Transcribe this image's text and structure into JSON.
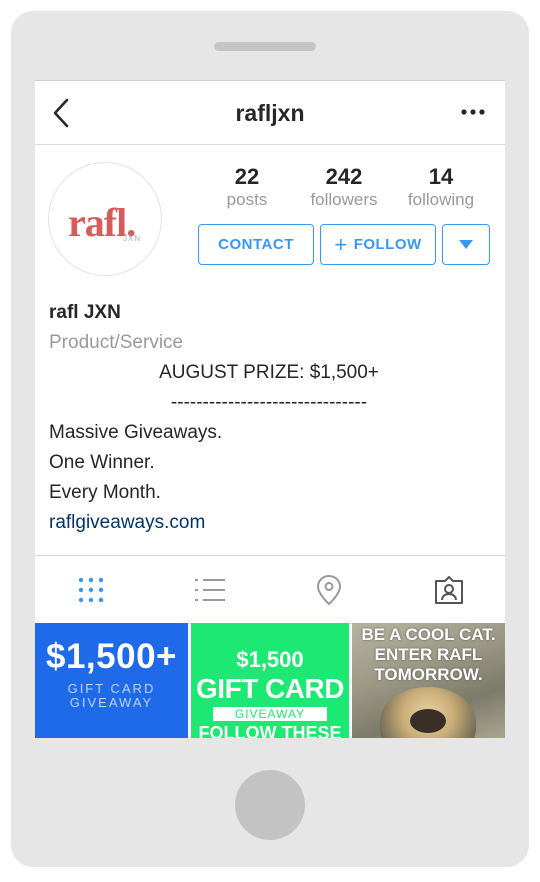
{
  "header": {
    "username": "rafljxn"
  },
  "profile": {
    "avatar": {
      "logo_text": "rafl.",
      "logo_subtext": "JXN"
    },
    "stats": [
      {
        "value": "22",
        "label": "posts"
      },
      {
        "value": "242",
        "label": "followers"
      },
      {
        "value": "14",
        "label": "following"
      }
    ],
    "buttons": {
      "contact": "CONTACT",
      "follow": "FOLLOW"
    }
  },
  "bio": {
    "name": "rafl JXN",
    "category": "Product/Service",
    "prize": "AUGUST PRIZE: $1,500+",
    "divider": "-------------------------------",
    "lines": [
      "Massive Giveaways.",
      "One Winner.",
      "Every Month."
    ],
    "link": "raflgiveaways.com"
  },
  "tabs": [
    {
      "name": "grid",
      "icon": "grid-icon",
      "active": true
    },
    {
      "name": "list",
      "icon": "list-icon",
      "active": false
    },
    {
      "name": "location",
      "icon": "location-pin-icon",
      "active": false
    },
    {
      "name": "tagged",
      "icon": "tagged-person-icon",
      "active": false
    }
  ],
  "posts": [
    {
      "title": "$1,500+",
      "line1": "GIFT CARD",
      "line2": "GIVEAWAY"
    },
    {
      "price": "$1,500",
      "title": "GIFT CARD",
      "band": "GIVEAWAY",
      "footer": "FOLLOW THESE"
    },
    {
      "line1": "BE A COOL CAT.",
      "line2": "ENTER RAFL",
      "line3": "TOMORROW."
    }
  ],
  "colors": {
    "accent": "#3897f0",
    "brand": "#d65c5c",
    "link": "#003569",
    "post1_bg": "#1e6ae8",
    "post2_bg": "#1ee874"
  }
}
